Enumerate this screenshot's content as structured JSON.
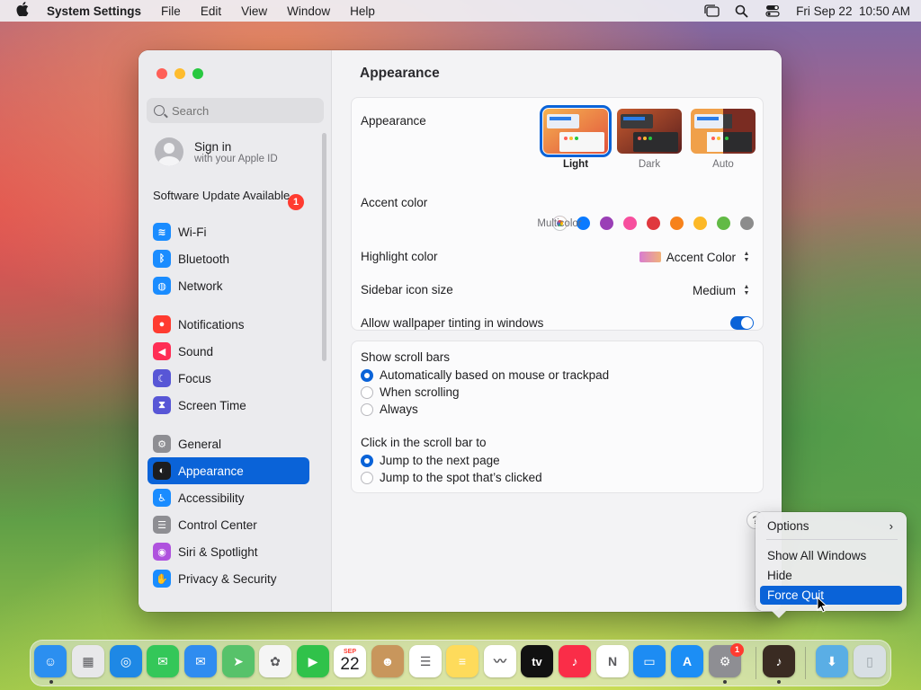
{
  "menubar": {
    "app_name": "System Settings",
    "menus": [
      "File",
      "Edit",
      "View",
      "Window",
      "Help"
    ],
    "clock": "Fri Sep 22  10:50 AM"
  },
  "sidebar": {
    "search_placeholder": "Search",
    "signin_title": "Sign in",
    "signin_subtitle": "with your Apple ID",
    "software_update": "Software Update Available",
    "update_badge": "1",
    "items": [
      {
        "label": "Wi-Fi",
        "color": "#1a8cff",
        "glyph": "≋"
      },
      {
        "label": "Bluetooth",
        "color": "#1a8cff",
        "glyph": "ᛒ"
      },
      {
        "label": "Network",
        "color": "#1a8cff",
        "glyph": "◍"
      },
      {
        "label": "Notifications",
        "color": "#ff3b30",
        "glyph": "●"
      },
      {
        "label": "Sound",
        "color": "#ff2d55",
        "glyph": "◀"
      },
      {
        "label": "Focus",
        "color": "#5856d6",
        "glyph": "☾"
      },
      {
        "label": "Screen Time",
        "color": "#5856d6",
        "glyph": "⧗"
      },
      {
        "label": "General",
        "color": "#8e8e93",
        "glyph": "⚙"
      },
      {
        "label": "Appearance",
        "color": "#1d1d1f",
        "glyph": "◐"
      },
      {
        "label": "Accessibility",
        "color": "#1a8cff",
        "glyph": "♿"
      },
      {
        "label": "Control Center",
        "color": "#8e8e93",
        "glyph": "☰"
      },
      {
        "label": "Siri & Spotlight",
        "color": "#af52de",
        "glyph": "◉"
      },
      {
        "label": "Privacy & Security",
        "color": "#1a8cff",
        "glyph": "✋"
      }
    ]
  },
  "main": {
    "title": "Appearance",
    "appearance_label": "Appearance",
    "modes": [
      "Light",
      "Dark",
      "Auto"
    ],
    "accent_label": "Accent color",
    "accent_caption": "Multicolor",
    "accent_colors": [
      "#ff9500",
      "#0a7aff",
      "#9a3fb6",
      "#f74f9e",
      "#e0383e",
      "#f7821b",
      "#fcb827",
      "#62ba46",
      "#8c8c8c"
    ],
    "highlight_label": "Highlight color",
    "highlight_value": "Accent Color",
    "sidebar_icon_label": "Sidebar icon size",
    "sidebar_icon_value": "Medium",
    "tinting_label": "Allow wallpaper tinting in windows",
    "scroll_bars_label": "Show scroll bars",
    "scroll_options": [
      "Automatically based on mouse or trackpad",
      "When scrolling",
      "Always"
    ],
    "click_label": "Click in the scroll bar to",
    "click_options": [
      "Jump to the next page",
      "Jump to the spot that’s clicked"
    ],
    "help": "?"
  },
  "context_menu": {
    "options": "Options",
    "show_all": "Show All Windows",
    "hide": "Hide",
    "force_quit": "Force Quit"
  },
  "dock": {
    "calendar_month": "SEP",
    "calendar_day": "22",
    "tv_label": "tv",
    "settings_badge": "1",
    "icons": [
      {
        "name": "finder",
        "color": "#2b8ff0"
      },
      {
        "name": "launchpad",
        "color": "#e8e8ea"
      },
      {
        "name": "safari",
        "color": "#1e88e5"
      },
      {
        "name": "messages",
        "color": "#34c759"
      },
      {
        "name": "mail",
        "color": "#2f8cf0"
      },
      {
        "name": "maps",
        "color": "#57c26a"
      },
      {
        "name": "photos",
        "color": "#f5f5f5"
      },
      {
        "name": "facetime",
        "color": "#30c24a"
      },
      {
        "name": "calendar",
        "color": "#ffffff"
      },
      {
        "name": "contacts",
        "color": "#c8965c"
      },
      {
        "name": "reminders",
        "color": "#ffffff"
      },
      {
        "name": "notes",
        "color": "#fedb5b"
      },
      {
        "name": "freeform",
        "color": "#ffffff"
      },
      {
        "name": "tv",
        "color": "#111111"
      },
      {
        "name": "music",
        "color": "#fa2d48"
      },
      {
        "name": "news",
        "color": "#ffffff"
      },
      {
        "name": "keynote",
        "color": "#1d8cf3"
      },
      {
        "name": "app-store",
        "color": "#1c8ef5"
      },
      {
        "name": "system-settings",
        "color": "#8e8e93"
      },
      {
        "name": "instruments",
        "color": "#3a2b22"
      },
      {
        "name": "downloads",
        "color": "#5aaee5"
      },
      {
        "name": "trash",
        "color": "#d8dfe4"
      }
    ]
  }
}
